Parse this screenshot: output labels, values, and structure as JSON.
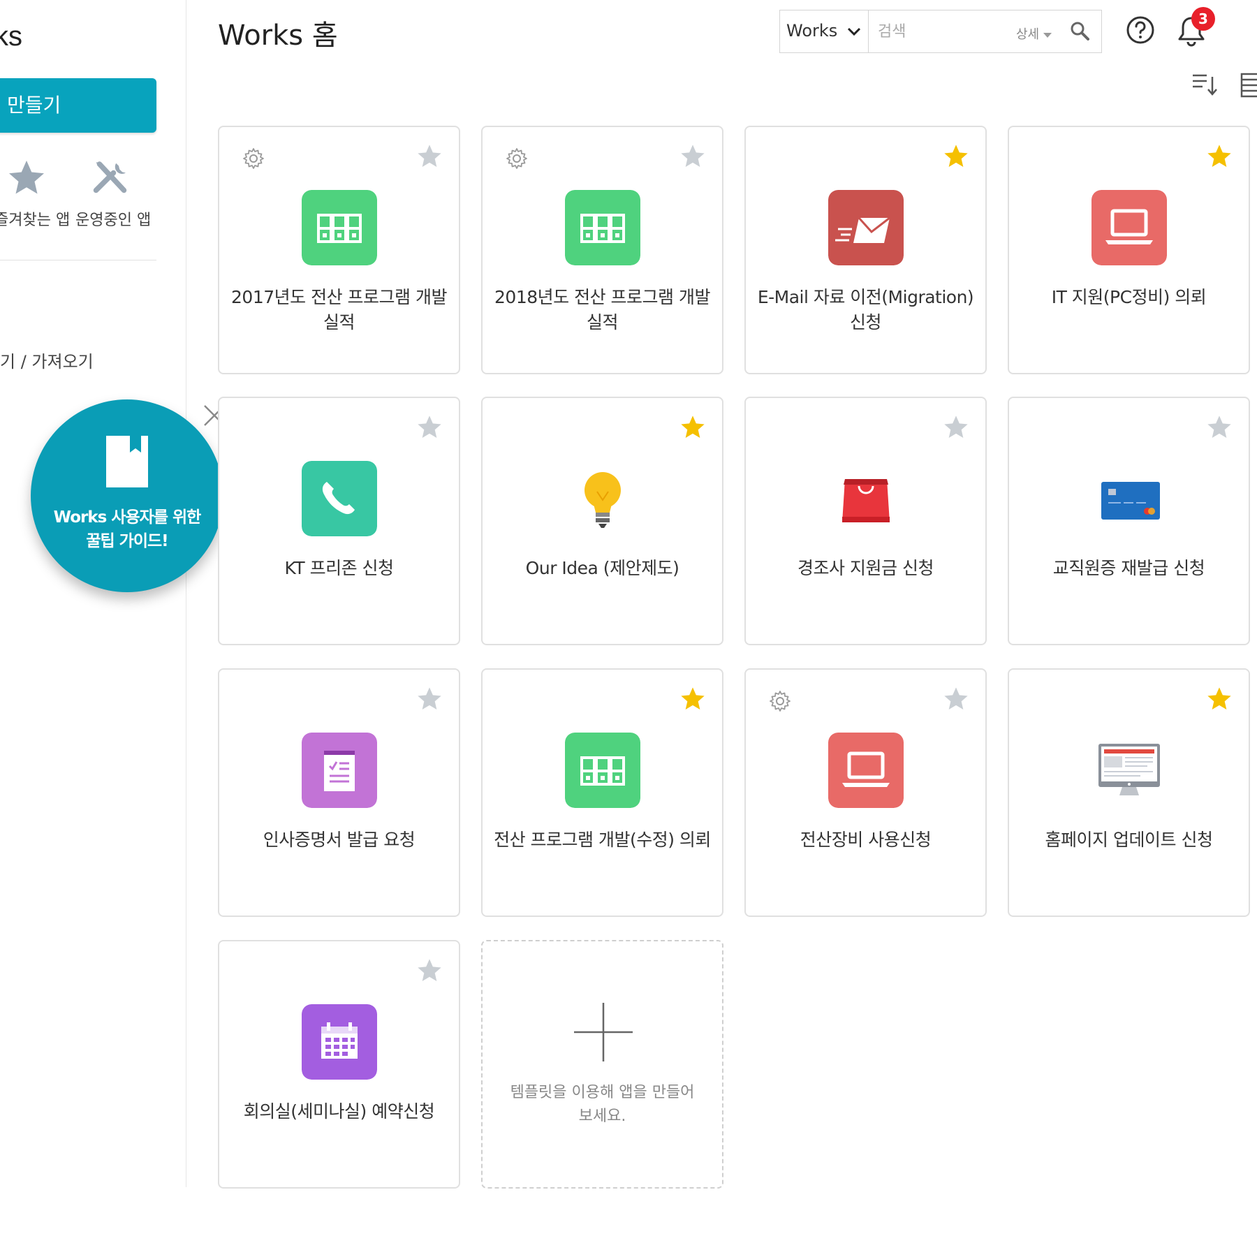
{
  "sidebar": {
    "title": "ks",
    "create_label": "만들기",
    "favorites_label": "즐겨찾는 앱",
    "operating_label": "운영중인 앱",
    "import_label": "기 / 가져오기",
    "tip_text_line1": "Works 사용자를 위한",
    "tip_text_line2": "꿀팁 가이드!"
  },
  "header": {
    "title": "Works 홈",
    "search_scope": "Works",
    "search_placeholder": "검색",
    "detail_label": "상세",
    "notification_count": "3"
  },
  "colors": {
    "accent": "#08a3bd",
    "star_on": "#f5c000",
    "star_off": "#c9ced3",
    "green": "#4fd27e",
    "red": "#e86a67",
    "dark_red": "#c9524e",
    "teal": "#38c7a3",
    "purple": "#c273d6",
    "violet": "#a35ee0"
  },
  "cards": [
    {
      "name": "2017년도 전산 프로그램 개발 실적",
      "icon": "folders-icon",
      "favorite": false,
      "gear": true
    },
    {
      "name": "2018년도 전산 프로그램 개발 실적",
      "icon": "folders-icon",
      "favorite": false,
      "gear": true
    },
    {
      "name": "E-Mail 자료 이전(Migration) 신청",
      "icon": "mail-icon",
      "favorite": true,
      "gear": false
    },
    {
      "name": "IT 지원(PC정비) 의뢰",
      "icon": "laptop-icon",
      "favorite": true,
      "gear": false
    },
    {
      "name": "KT 프리존 신청",
      "icon": "phone-icon",
      "favorite": false,
      "gear": false
    },
    {
      "name": "Our Idea (제안제도)",
      "icon": "lightbulb-icon",
      "favorite": true,
      "gear": false
    },
    {
      "name": "경조사 지원금 신청",
      "icon": "shopping-bag-icon",
      "favorite": false,
      "gear": false
    },
    {
      "name": "교직원증 재발급 신청",
      "icon": "id-card-icon",
      "favorite": false,
      "gear": false
    },
    {
      "name": "인사증명서 발급 요청",
      "icon": "notepad-icon",
      "favorite": false,
      "gear": false
    },
    {
      "name": "전산 프로그램 개발(수정) 의뢰",
      "icon": "folders-icon",
      "favorite": true,
      "gear": false
    },
    {
      "name": "전산장비 사용신청",
      "icon": "laptop-icon",
      "favorite": false,
      "gear": true
    },
    {
      "name": "홈페이지 업데이트 신청",
      "icon": "monitor-icon",
      "favorite": true,
      "gear": false
    },
    {
      "name": "회의실(세미나실) 예약신청",
      "icon": "calendar-icon",
      "favorite": false,
      "gear": false
    }
  ],
  "add_card": {
    "text_line1": "템플릿을 이용해 앱을 만들어",
    "text_line2": "보세요."
  }
}
